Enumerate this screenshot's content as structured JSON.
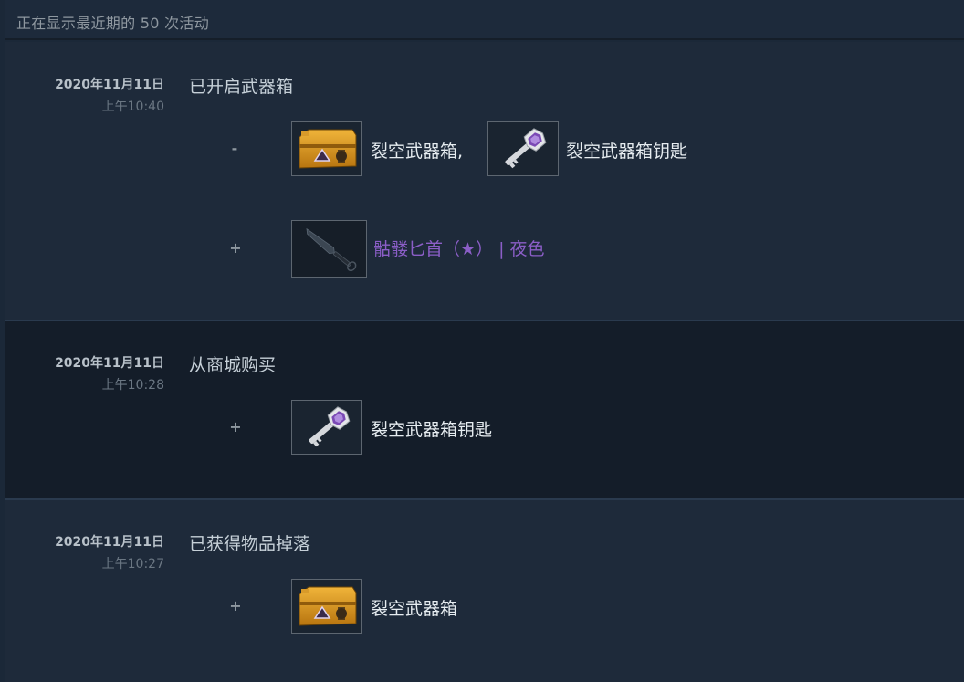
{
  "header": {
    "showing_text": "正在显示最近期的 50 次活动"
  },
  "events": [
    {
      "date": "2020年11月11日",
      "time": "上午10:40",
      "description": "已开启武器箱",
      "minus_sign": "-",
      "plus_sign": "+",
      "items_lost": [
        {
          "name": "裂空武器箱,",
          "icon": "weapon-case-icon"
        },
        {
          "name": "裂空武器箱钥匙",
          "icon": "case-key-icon"
        }
      ],
      "items_gained": [
        {
          "name": "骷髅匕首（★） | 夜色",
          "icon": "skeleton-knife-icon",
          "color": "#8b5ec7"
        }
      ]
    },
    {
      "date": "2020年11月11日",
      "time": "上午10:28",
      "description": "从商城购买",
      "plus_sign": "+",
      "items_gained": [
        {
          "name": "裂空武器箱钥匙",
          "icon": "case-key-icon"
        }
      ]
    },
    {
      "date": "2020年11月11日",
      "time": "上午10:27",
      "description": "已获得物品掉落",
      "plus_sign": "+",
      "items_gained": [
        {
          "name": "裂空武器箱",
          "icon": "weapon-case-icon"
        }
      ]
    }
  ],
  "colors": {
    "background": "#1b2838",
    "rare_item": "#8b5ec7",
    "text_light": "#e6ecf0",
    "text_muted": "#8f98a0"
  }
}
